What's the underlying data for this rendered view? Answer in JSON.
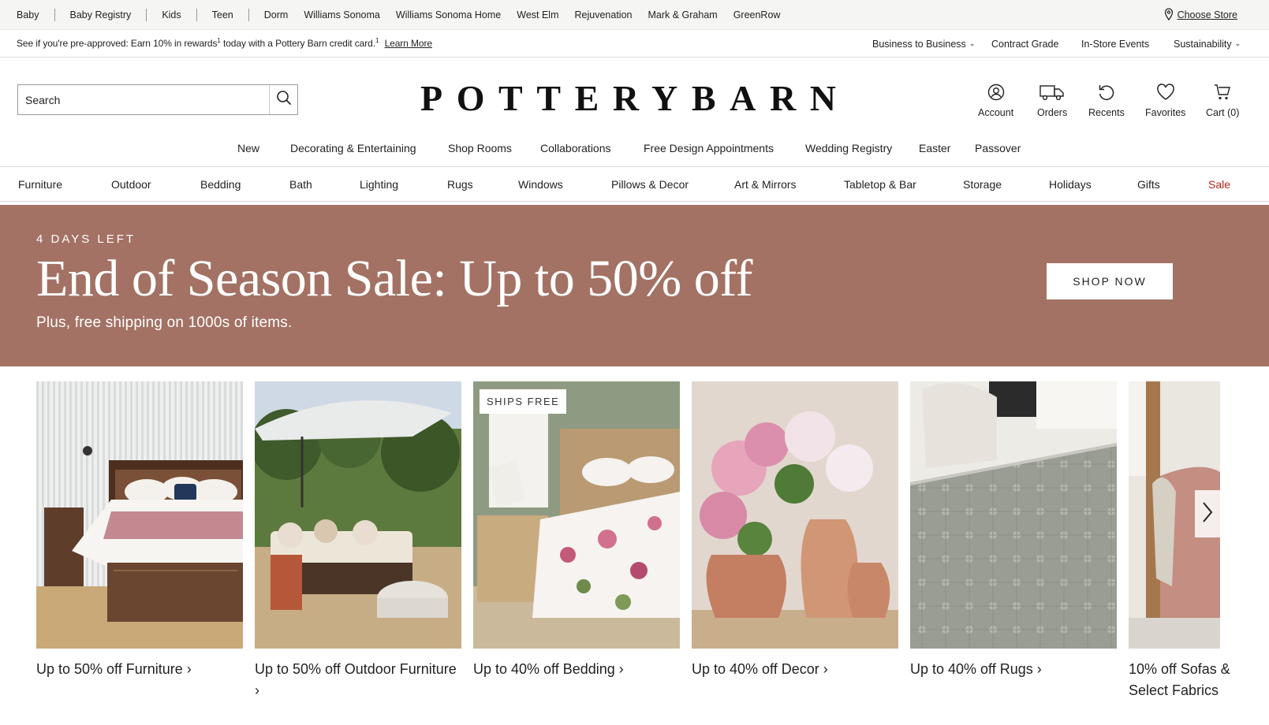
{
  "brand_bar": {
    "links": [
      "Baby",
      "Baby Registry",
      "Kids",
      "Teen",
      "Dorm",
      "Williams Sonoma",
      "Williams Sonoma Home",
      "West Elm",
      "Rejuvenation",
      "Mark & Graham",
      "GreenRow"
    ],
    "choose_store": "Choose Store"
  },
  "promo": {
    "message": "See if you're pre-approved: Earn 10% in rewards",
    "sup": "1",
    "message2": " today with a Pottery Barn credit card.",
    "sup2": "1",
    "learn_more": "Learn More",
    "right_links": [
      "Business to Business",
      "Contract Grade",
      "In-Store Events",
      "Sustainability"
    ]
  },
  "header": {
    "search_placeholder": "Search",
    "logo": "POTTERYBARN",
    "utility": [
      {
        "label": "Account",
        "icon": "account-icon"
      },
      {
        "label": "Orders",
        "icon": "truck-icon"
      },
      {
        "label": "Recents",
        "icon": "recents-icon"
      },
      {
        "label": "Favorites",
        "icon": "heart-icon"
      },
      {
        "label": "Cart (0)",
        "icon": "cart-icon"
      }
    ]
  },
  "top_nav": [
    "New",
    "Decorating & Entertaining",
    "Shop Rooms",
    "Collaborations",
    "Free Design Appointments",
    "Wedding Registry",
    "Easter",
    "Passover"
  ],
  "main_nav": [
    "Furniture",
    "Outdoor",
    "Bedding",
    "Bath",
    "Lighting",
    "Rugs",
    "Windows",
    "Pillows & Decor",
    "Art & Mirrors",
    "Tabletop & Bar",
    "Storage",
    "Holidays",
    "Gifts",
    "Sale"
  ],
  "hero": {
    "eyebrow": "4 DAYS LEFT",
    "headline": "End of Season Sale: Up to 50% off",
    "sub": "Plus, free shipping on 1000s of items.",
    "cta": "SHOP NOW",
    "bg_color": "#a37264"
  },
  "cards": [
    {
      "caption": "Up to 50% off Furniture ›",
      "image": "bedroom-image"
    },
    {
      "caption": "Up to 50% off Outdoor Furniture ›",
      "image": "outdoor-image"
    },
    {
      "caption": "Up to 40% off Bedding ›",
      "image": "bedding-image",
      "badge": "SHIPS FREE"
    },
    {
      "caption": "Up to 40% off Decor ›",
      "image": "decor-image"
    },
    {
      "caption": "Up to 40% off Rugs ›",
      "image": "rug-image"
    },
    {
      "caption": "10% off Sofas & Select Fabrics",
      "image": "sofa-image"
    }
  ],
  "accent_sale": "#b3261e"
}
